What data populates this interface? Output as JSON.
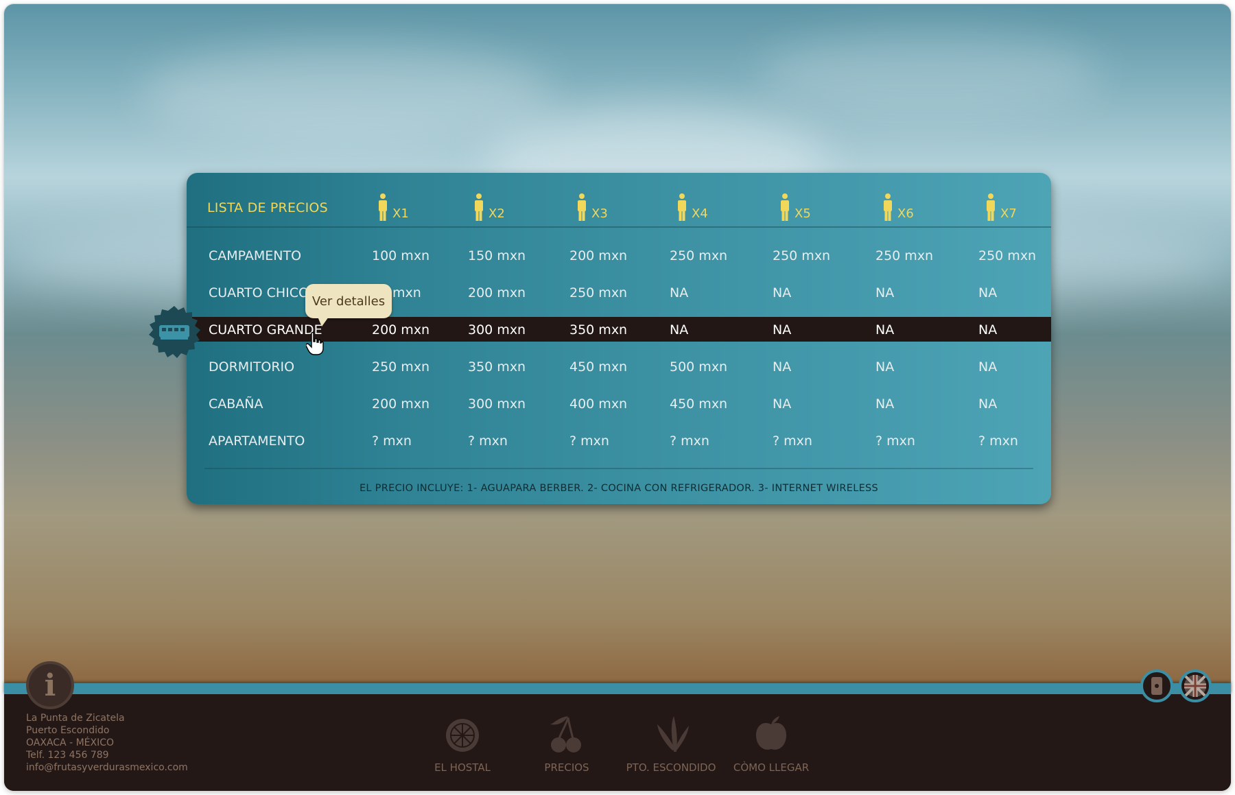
{
  "price_table": {
    "title": "LISTA DE PRECIOS",
    "columns": [
      "X1",
      "X2",
      "X3",
      "X4",
      "X5",
      "X6",
      "X7"
    ],
    "rows": [
      {
        "name": "CAMPAMENTO",
        "values": [
          "100 mxn",
          "150 mxn",
          "200 mxn",
          "250 mxn",
          "250 mxn",
          "250 mxn",
          "250 mxn"
        ]
      },
      {
        "name": "CUARTO CHICO",
        "values": [
          "mxn",
          "200 mxn",
          "250 mxn",
          "NA",
          "NA",
          "NA",
          "NA"
        ]
      },
      {
        "name": "CUARTO GRANDE",
        "values": [
          "200 mxn",
          "300 mxn",
          "350 mxn",
          "NA",
          "NA",
          "NA",
          "NA"
        ]
      },
      {
        "name": "DORMITORIO",
        "values": [
          "250 mxn",
          "350 mxn",
          "450 mxn",
          "500 mxn",
          "NA",
          "NA",
          "NA"
        ]
      },
      {
        "name": "CABAÑA",
        "values": [
          "200 mxn",
          "300 mxn",
          "400 mxn",
          "450 mxn",
          "NA",
          "NA",
          "NA"
        ]
      },
      {
        "name": "APARTAMENTO",
        "values": [
          "? mxn",
          "? mxn",
          "? mxn",
          "? mxn",
          "? mxn",
          "? mxn",
          "? mxn"
        ]
      }
    ],
    "selected_row": "CUARTO GRANDE",
    "footnote": "EL PRECIO INCLUYE: 1- AGUAPARA BERBER. 2- COCINA CON REFRIGERADOR. 3- INTERNET WIRELESS",
    "person_icon": "person-icon"
  },
  "tooltip": {
    "text": "Ver detalles"
  },
  "contact": {
    "line1": "La Punta de Zicatela",
    "line2": "Puerto Escondido",
    "line3": "OAXACA - MÉXICO",
    "line4": "Telf. 123 456 789",
    "line5": "info@frutasyverdurasmexico.com"
  },
  "nav": [
    {
      "label": "EL HOSTAL",
      "icon": "orange-icon"
    },
    {
      "label": "PRECIOS",
      "icon": "cherries-icon"
    },
    {
      "label": "PTO. ESCONDIDO",
      "icon": "bananas-icon"
    },
    {
      "label": "CÒMO LLEGAR",
      "icon": "apple-icon"
    }
  ],
  "info_button": {
    "label": "i"
  },
  "colors": {
    "accent": "#f1d75a",
    "panel": "#3e93a5",
    "footer": "#241816",
    "bar": "#3b8ea3"
  }
}
